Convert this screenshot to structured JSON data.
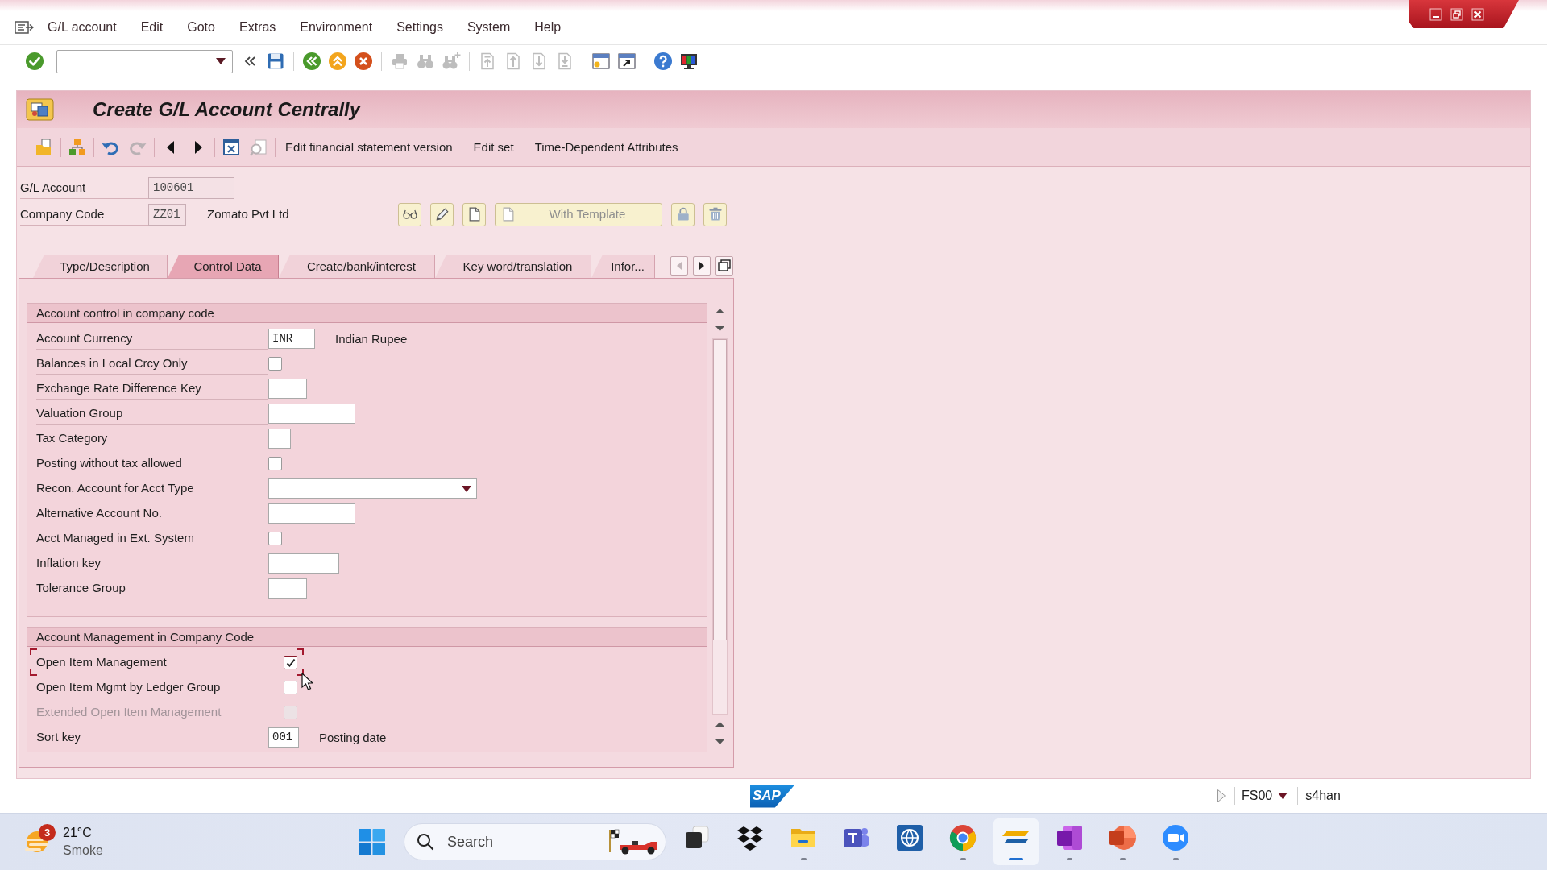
{
  "menu_bar": [
    "G/L account",
    "Edit",
    "Goto",
    "Extras",
    "Environment",
    "Settings",
    "System",
    "Help"
  ],
  "toolbar": {
    "groups": [
      [
        {
          "kind": "enter",
          "disabled": false
        }
      ],
      [
        {
          "kind": "save",
          "disabled": false
        }
      ],
      [
        {
          "kind": "back",
          "disabled": false
        },
        {
          "kind": "exit",
          "disabled": false
        },
        {
          "kind": "cancel",
          "disabled": false
        }
      ],
      [
        {
          "kind": "print",
          "disabled": true
        },
        {
          "kind": "find",
          "disabled": true
        },
        {
          "kind": "find_next",
          "disabled": true
        }
      ],
      [
        {
          "kind": "first_page",
          "disabled": true
        },
        {
          "kind": "previous_page",
          "disabled": true
        },
        {
          "kind": "next_page",
          "disabled": true
        },
        {
          "kind": "last_page",
          "disabled": true
        }
      ],
      [
        {
          "kind": "new_session",
          "disabled": false
        },
        {
          "kind": "shortcut",
          "disabled": false
        }
      ],
      [
        {
          "kind": "help",
          "disabled": false
        },
        {
          "kind": "customize_layout",
          "disabled": false
        }
      ]
    ]
  },
  "title": "Create G/L Account Centrally",
  "app_toolbar": {
    "icon_groups": [
      [
        {
          "kind": "object_folder",
          "disabled": false
        }
      ],
      [
        {
          "kind": "hierarchy",
          "disabled": false
        }
      ],
      [
        {
          "kind": "undo",
          "disabled": false
        },
        {
          "kind": "redo",
          "disabled": true
        }
      ],
      [
        {
          "kind": "previous",
          "disabled": false
        },
        {
          "kind": "next",
          "disabled": false
        }
      ],
      [
        {
          "kind": "document_delete",
          "disabled": false
        },
        {
          "kind": "document_search",
          "disabled": true
        }
      ]
    ],
    "buttons": [
      "Edit financial statement version",
      "Edit set",
      "Time-Dependent Attributes"
    ]
  },
  "header": {
    "fields": [
      {
        "label": "G/L Account",
        "value": "100601"
      },
      {
        "label": "Company Code",
        "value": "ZZ01",
        "description": "Zomato Pvt Ltd"
      }
    ],
    "buttons": [
      {
        "kind": "display",
        "disabled": false
      },
      {
        "kind": "change",
        "disabled": false
      },
      {
        "kind": "create",
        "disabled": false
      },
      {
        "kind": "create_with_template",
        "label": "With Template",
        "disabled": true
      },
      {
        "kind": "lock",
        "disabled": false
      },
      {
        "kind": "delete",
        "disabled": false
      }
    ]
  },
  "tabs": [
    {
      "label": "Type/Description",
      "selected": false
    },
    {
      "label": "Control Data",
      "selected": true
    },
    {
      "label": "Create/bank/interest",
      "selected": false
    },
    {
      "label": "Key word/translation",
      "selected": false
    },
    {
      "label": "Infor...",
      "selected": false
    }
  ],
  "tab_scroll": [
    {
      "kind": "left",
      "disabled": true
    },
    {
      "kind": "right",
      "disabled": false
    },
    {
      "kind": "list",
      "disabled": false
    }
  ],
  "sections": [
    {
      "title": "Account control in company code",
      "rows": [
        {
          "kind": "input",
          "label": "Account Currency",
          "value": "INR",
          "description": "Indian Rupee",
          "disabled": false,
          "focused": false
        },
        {
          "kind": "checkbox",
          "label": "Balances in Local Crcy Only",
          "checked": false,
          "disabled": false,
          "focused": false
        },
        {
          "kind": "input",
          "label": "Exchange Rate Difference Key",
          "disabled": false,
          "focused": false
        },
        {
          "kind": "input",
          "label": "Valuation Group",
          "disabled": false,
          "focused": false
        },
        {
          "kind": "input",
          "label": "Tax Category",
          "disabled": false,
          "focused": false
        },
        {
          "kind": "checkbox",
          "label": "Posting without tax allowed",
          "checked": false,
          "disabled": false,
          "focused": false
        },
        {
          "kind": "dropdown",
          "label": "Recon. Account for Acct Type",
          "disabled": false,
          "focused": false
        },
        {
          "kind": "input",
          "label": "Alternative Account No.",
          "disabled": false,
          "focused": false
        },
        {
          "kind": "checkbox",
          "label": "Acct Managed in Ext. System",
          "checked": false,
          "disabled": false,
          "focused": false
        },
        {
          "kind": "input",
          "label": "Inflation key",
          "disabled": false,
          "focused": false
        },
        {
          "kind": "input",
          "label": "Tolerance Group",
          "disabled": false,
          "focused": false
        }
      ]
    },
    {
      "title": "Account Management in Company Code",
      "rows": [
        {
          "kind": "checkbox",
          "label": "Open Item Management",
          "checked": true,
          "disabled": false,
          "focused": true
        },
        {
          "kind": "checkbox",
          "label": "Open Item Mgmt by Ledger Group",
          "checked": false,
          "disabled": false,
          "focused": false
        },
        {
          "kind": "checkbox",
          "label": "Extended Open Item Management",
          "checked": false,
          "disabled": true,
          "focused": false
        },
        {
          "kind": "input",
          "label": "Sort key",
          "value": "001",
          "description": "Posting date",
          "disabled": false,
          "focused": false
        }
      ]
    }
  ],
  "status_bar": {
    "logo": "SAP",
    "transaction": "FS00",
    "system": "s4han"
  },
  "taskbar": {
    "weather": {
      "temperature": "21°C",
      "condition": "Smoke",
      "badge": "3"
    },
    "search": {
      "placeholder": "Search"
    },
    "apps": [
      {
        "kind": "task_view",
        "running": false,
        "selected": false
      },
      {
        "kind": "dropbox",
        "running": false,
        "selected": false
      },
      {
        "kind": "file_explorer",
        "running": true,
        "selected": false
      },
      {
        "kind": "teams",
        "running": false,
        "selected": false
      },
      {
        "kind": "globe_app",
        "running": false,
        "selected": false
      },
      {
        "kind": "chrome",
        "running": true,
        "selected": false
      },
      {
        "kind": "sap_logon",
        "running": true,
        "selected": true
      },
      {
        "kind": "onenote",
        "running": true,
        "selected": false
      },
      {
        "kind": "powerpoint",
        "running": true,
        "selected": false
      },
      {
        "kind": "zoom",
        "running": true,
        "selected": false
      }
    ]
  }
}
